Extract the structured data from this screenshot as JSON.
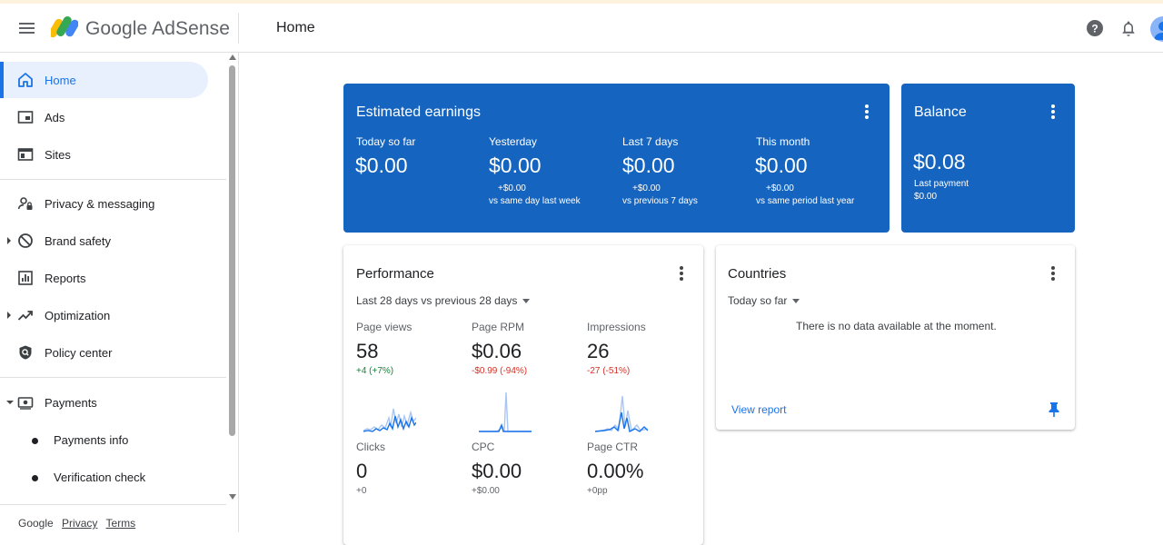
{
  "header": {
    "brand": "Google AdSense",
    "page_title": "Home"
  },
  "colors": {
    "accent": "#1a73e8",
    "card_blue": "#1565c0",
    "positive": "#188038",
    "negative": "#d93025"
  },
  "sidebar": {
    "items": [
      {
        "label": "Home",
        "icon": "home-icon"
      },
      {
        "label": "Ads",
        "icon": "ads-icon"
      },
      {
        "label": "Sites",
        "icon": "sites-icon"
      },
      {
        "label": "Privacy & messaging",
        "icon": "privacy-icon"
      },
      {
        "label": "Brand safety",
        "icon": "block-icon"
      },
      {
        "label": "Reports",
        "icon": "reports-icon"
      },
      {
        "label": "Optimization",
        "icon": "trending-up-icon"
      },
      {
        "label": "Policy center",
        "icon": "policy-shield-icon"
      },
      {
        "label": "Payments",
        "icon": "payments-icon"
      },
      {
        "label": "Payments info"
      },
      {
        "label": "Verification check"
      }
    ],
    "footer": {
      "google": "Google",
      "privacy": "Privacy",
      "terms": "Terms"
    }
  },
  "earnings": {
    "title": "Estimated earnings",
    "metrics": [
      {
        "label": "Today so far",
        "value": "$0.00",
        "delta": "",
        "comparison": ""
      },
      {
        "label": "Yesterday",
        "value": "$0.00",
        "delta": "+$0.00",
        "comparison": "vs same day last week"
      },
      {
        "label": "Last 7 days",
        "value": "$0.00",
        "delta": "+$0.00",
        "comparison": "vs previous 7 days"
      },
      {
        "label": "This month",
        "value": "$0.00",
        "delta": "+$0.00",
        "comparison": "vs same period last year"
      }
    ]
  },
  "balance": {
    "title": "Balance",
    "value": "$0.08",
    "last_payment_label": "Last payment",
    "last_payment_value": "$0.00"
  },
  "performance": {
    "title": "Performance",
    "range": "Last 28 days vs previous 28 days",
    "metrics": [
      {
        "label": "Page views",
        "value": "58",
        "delta": "+4 (+7%)",
        "trend": "positive"
      },
      {
        "label": "Page RPM",
        "value": "$0.06",
        "delta": "-$0.99 (-94%)",
        "trend": "negative"
      },
      {
        "label": "Impressions",
        "value": "26",
        "delta": "-27 (-51%)",
        "trend": "negative"
      },
      {
        "label": "Clicks",
        "value": "0",
        "delta": "+0",
        "trend": "neutral"
      },
      {
        "label": "CPC",
        "value": "$0.00",
        "delta": "+$0.00",
        "trend": "neutral"
      },
      {
        "label": "Page CTR",
        "value": "0.00%",
        "delta": "+0pp",
        "trend": "neutral"
      }
    ]
  },
  "countries": {
    "title": "Countries",
    "range": "Today so far",
    "empty_message": "There is no data available at the moment.",
    "view_report": "View report"
  }
}
